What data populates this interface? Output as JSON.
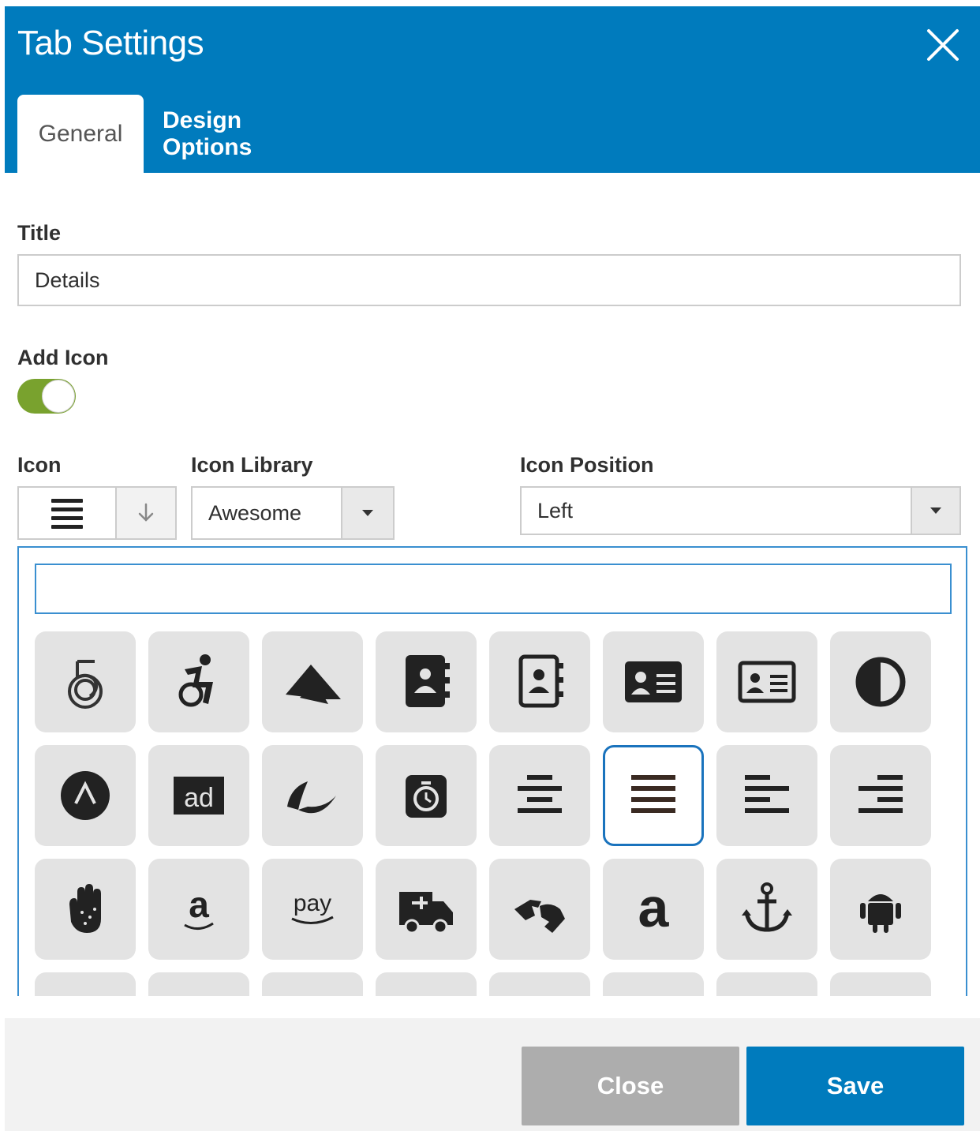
{
  "dialog": {
    "title": "Tab Settings",
    "close_icon": "close-icon"
  },
  "tabs": [
    {
      "label": "General",
      "active": true
    },
    {
      "label": "Design Options",
      "active": false
    }
  ],
  "form": {
    "title_label": "Title",
    "title_value": "Details",
    "add_icon_label": "Add Icon",
    "add_icon_enabled": true,
    "icon_label": "Icon",
    "icon_selected": "align-justify-icon",
    "icon_library_label": "Icon Library",
    "icon_library_value": "Awesome",
    "icon_position_label": "Icon Position",
    "icon_position_value": "Left"
  },
  "picker": {
    "search_value": "",
    "icons": [
      "500px-icon",
      "accessible-icon",
      "accusoft-icon",
      "address-book-icon",
      "address-book-outline-icon",
      "address-card-icon",
      "address-card-outline-icon",
      "adjust-icon",
      "adversal-icon",
      "ad-icon",
      "affiliatetheme-icon",
      "stopwatch-icon",
      "align-center-icon",
      "align-justify-icon",
      "align-left-icon",
      "align-right-icon",
      "allergies-icon",
      "amazon-icon",
      "amazon-pay-icon",
      "ambulance-icon",
      "sign-language-icon",
      "angellist-icon",
      "anchor-icon",
      "android-icon"
    ],
    "selected_icon": "align-justify-icon"
  },
  "footer": {
    "close_label": "Close",
    "save_label": "Save"
  },
  "colors": {
    "header": "#007bbd",
    "toggle_on": "#79a22e",
    "selected_border": "#1a73bd",
    "tile_bg": "#e3e3e3"
  }
}
